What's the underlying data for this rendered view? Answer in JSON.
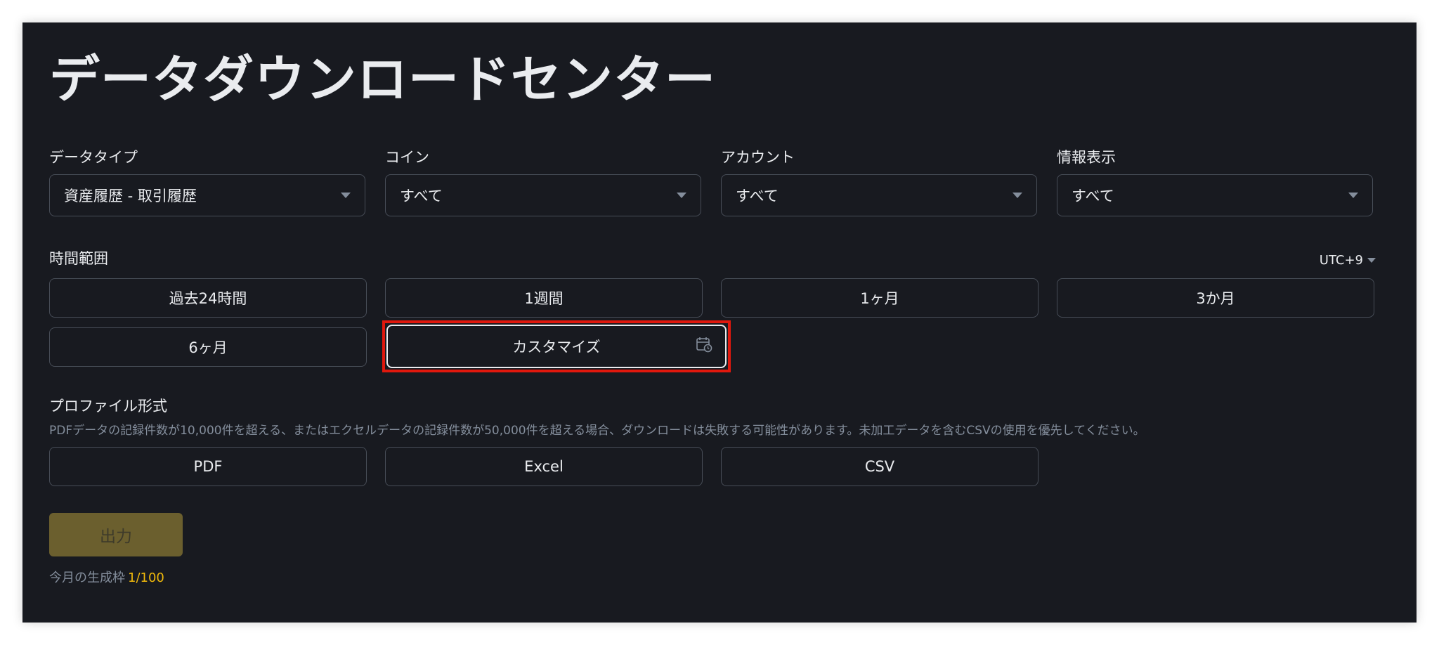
{
  "title": "データダウンロードセンター",
  "filters": [
    {
      "label": "データタイプ",
      "value": "資産履歴 - 取引履歴"
    },
    {
      "label": "コイン",
      "value": "すべて"
    },
    {
      "label": "アカウント",
      "value": "すべて"
    },
    {
      "label": "情報表示",
      "value": "すべて"
    }
  ],
  "time_range": {
    "label": "時間範囲",
    "timezone": "UTC+9",
    "options": [
      "過去24時間",
      "1週間",
      "1ヶ月",
      "3か月",
      "6ヶ月",
      "カスタマイズ"
    ]
  },
  "profile": {
    "label": "プロファイル形式",
    "note": "PDFデータの記録件数が10,000件を超える、またはエクセルデータの記録件数が50,000件を超える場合、ダウンロードは失敗する可能性があります。未加工データを含むCSVの使用を優先してください。",
    "formats": [
      "PDF",
      "Excel",
      "CSV"
    ]
  },
  "export_label": "出力",
  "quota": {
    "label": "今月の生成枠",
    "value": "1/100"
  },
  "colors": {
    "panel_bg": "#181a20",
    "accent": "#f0b90b",
    "highlight": "#e0180d"
  }
}
